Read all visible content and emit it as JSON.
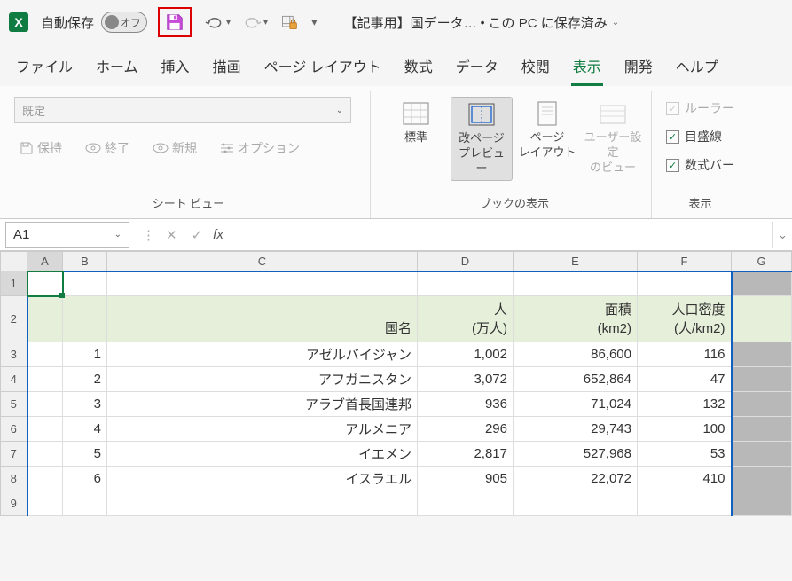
{
  "titlebar": {
    "autosave_label": "自動保存",
    "autosave_state": "オフ",
    "doc_name": "【記事用】国データ…",
    "saved_hint": "この PC に保存済み"
  },
  "tabs": [
    "ファイル",
    "ホーム",
    "挿入",
    "描画",
    "ページ レイアウト",
    "数式",
    "データ",
    "校閲",
    "表示",
    "開発",
    "ヘルプ"
  ],
  "active_tab": "表示",
  "ribbon": {
    "sheetview": {
      "select_placeholder": "既定",
      "keep": "保持",
      "exit": "終了",
      "new": "新規",
      "options": "オプション",
      "group_label": "シート ビュー"
    },
    "workbook_views": {
      "normal": "標準",
      "pagebreak_l1": "改ページ",
      "pagebreak_l2": "プレビュー",
      "pagelayout_l1": "ページ",
      "pagelayout_l2": "レイアウト",
      "custom_l1": "ユーザー設定",
      "custom_l2": "のビュー",
      "group_label": "ブックの表示"
    },
    "show": {
      "ruler": "ルーラー",
      "gridlines": "目盛線",
      "formulabar": "数式バー",
      "group_label": "表示"
    }
  },
  "namebox": {
    "value": "A1"
  },
  "grid": {
    "columns": [
      "A",
      "B",
      "C",
      "D",
      "E",
      "F",
      "G"
    ],
    "header": {
      "country": "国名",
      "pop_l1": "人",
      "pop_l2": "(万人)",
      "area_l1": "面積",
      "area_l2": "(km2)",
      "density_l1": "人口密度",
      "density_l2": "(人/km2)"
    },
    "rows": [
      {
        "n": "1",
        "country": "アゼルバイジャン",
        "pop": "1,002",
        "area": "86,600",
        "density": "116"
      },
      {
        "n": "2",
        "country": "アフガニスタン",
        "pop": "3,072",
        "area": "652,864",
        "density": "47"
      },
      {
        "n": "3",
        "country": "アラブ首長国連邦",
        "pop": "936",
        "area": "71,024",
        "density": "132"
      },
      {
        "n": "4",
        "country": "アルメニア",
        "pop": "296",
        "area": "29,743",
        "density": "100"
      },
      {
        "n": "5",
        "country": "イエメン",
        "pop": "2,817",
        "area": "527,968",
        "density": "53"
      },
      {
        "n": "6",
        "country": "イスラエル",
        "pop": "905",
        "area": "22,072",
        "density": "410"
      }
    ]
  }
}
